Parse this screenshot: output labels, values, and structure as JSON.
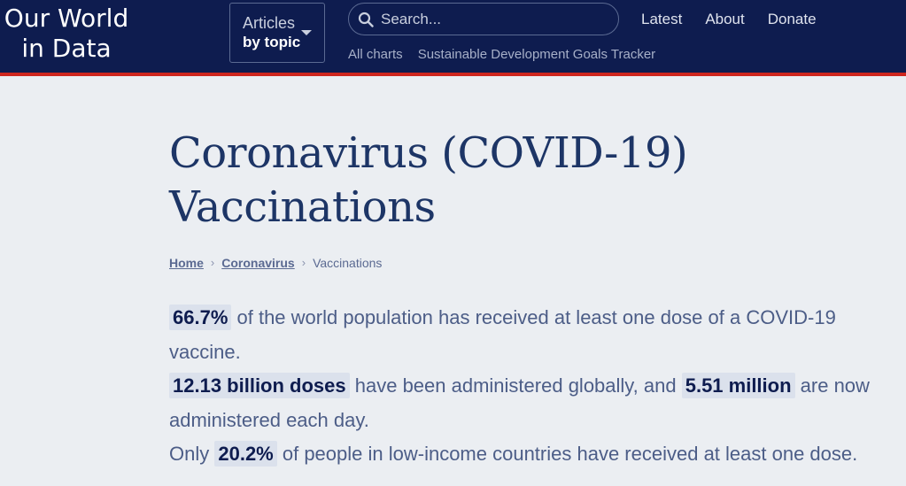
{
  "header": {
    "logo": [
      "Our World",
      "in Data"
    ],
    "articles_button": {
      "line1": "Articles",
      "line2": "by topic"
    },
    "search": {
      "placeholder": "Search..."
    },
    "nav": [
      "Latest",
      "About",
      "Donate"
    ],
    "subnav": [
      "All charts",
      "Sustainable Development Goals Tracker"
    ],
    "colors": {
      "bar": "#0e1c4f",
      "accent_line": "#ce261e"
    }
  },
  "page": {
    "title_line1": "Coronavirus (COVID-19)",
    "title_line2": "Vaccinations",
    "breadcrumb": {
      "home": "Home",
      "section": "Coronavirus",
      "current": "Vaccinations"
    }
  },
  "facts": [
    {
      "highlight": "66.7%",
      "text": " of the world population has received at least one dose of a COVID-19 vaccine."
    },
    {
      "highlight": "12.13 billion doses",
      "text_mid": " have been administered globally, and ",
      "highlight2": "5.51 million",
      "text_end": " are now administered each day."
    },
    {
      "prefix": "Only ",
      "highlight": "20.2%",
      "text": " of people in low-income countries have received at least one dose."
    }
  ]
}
